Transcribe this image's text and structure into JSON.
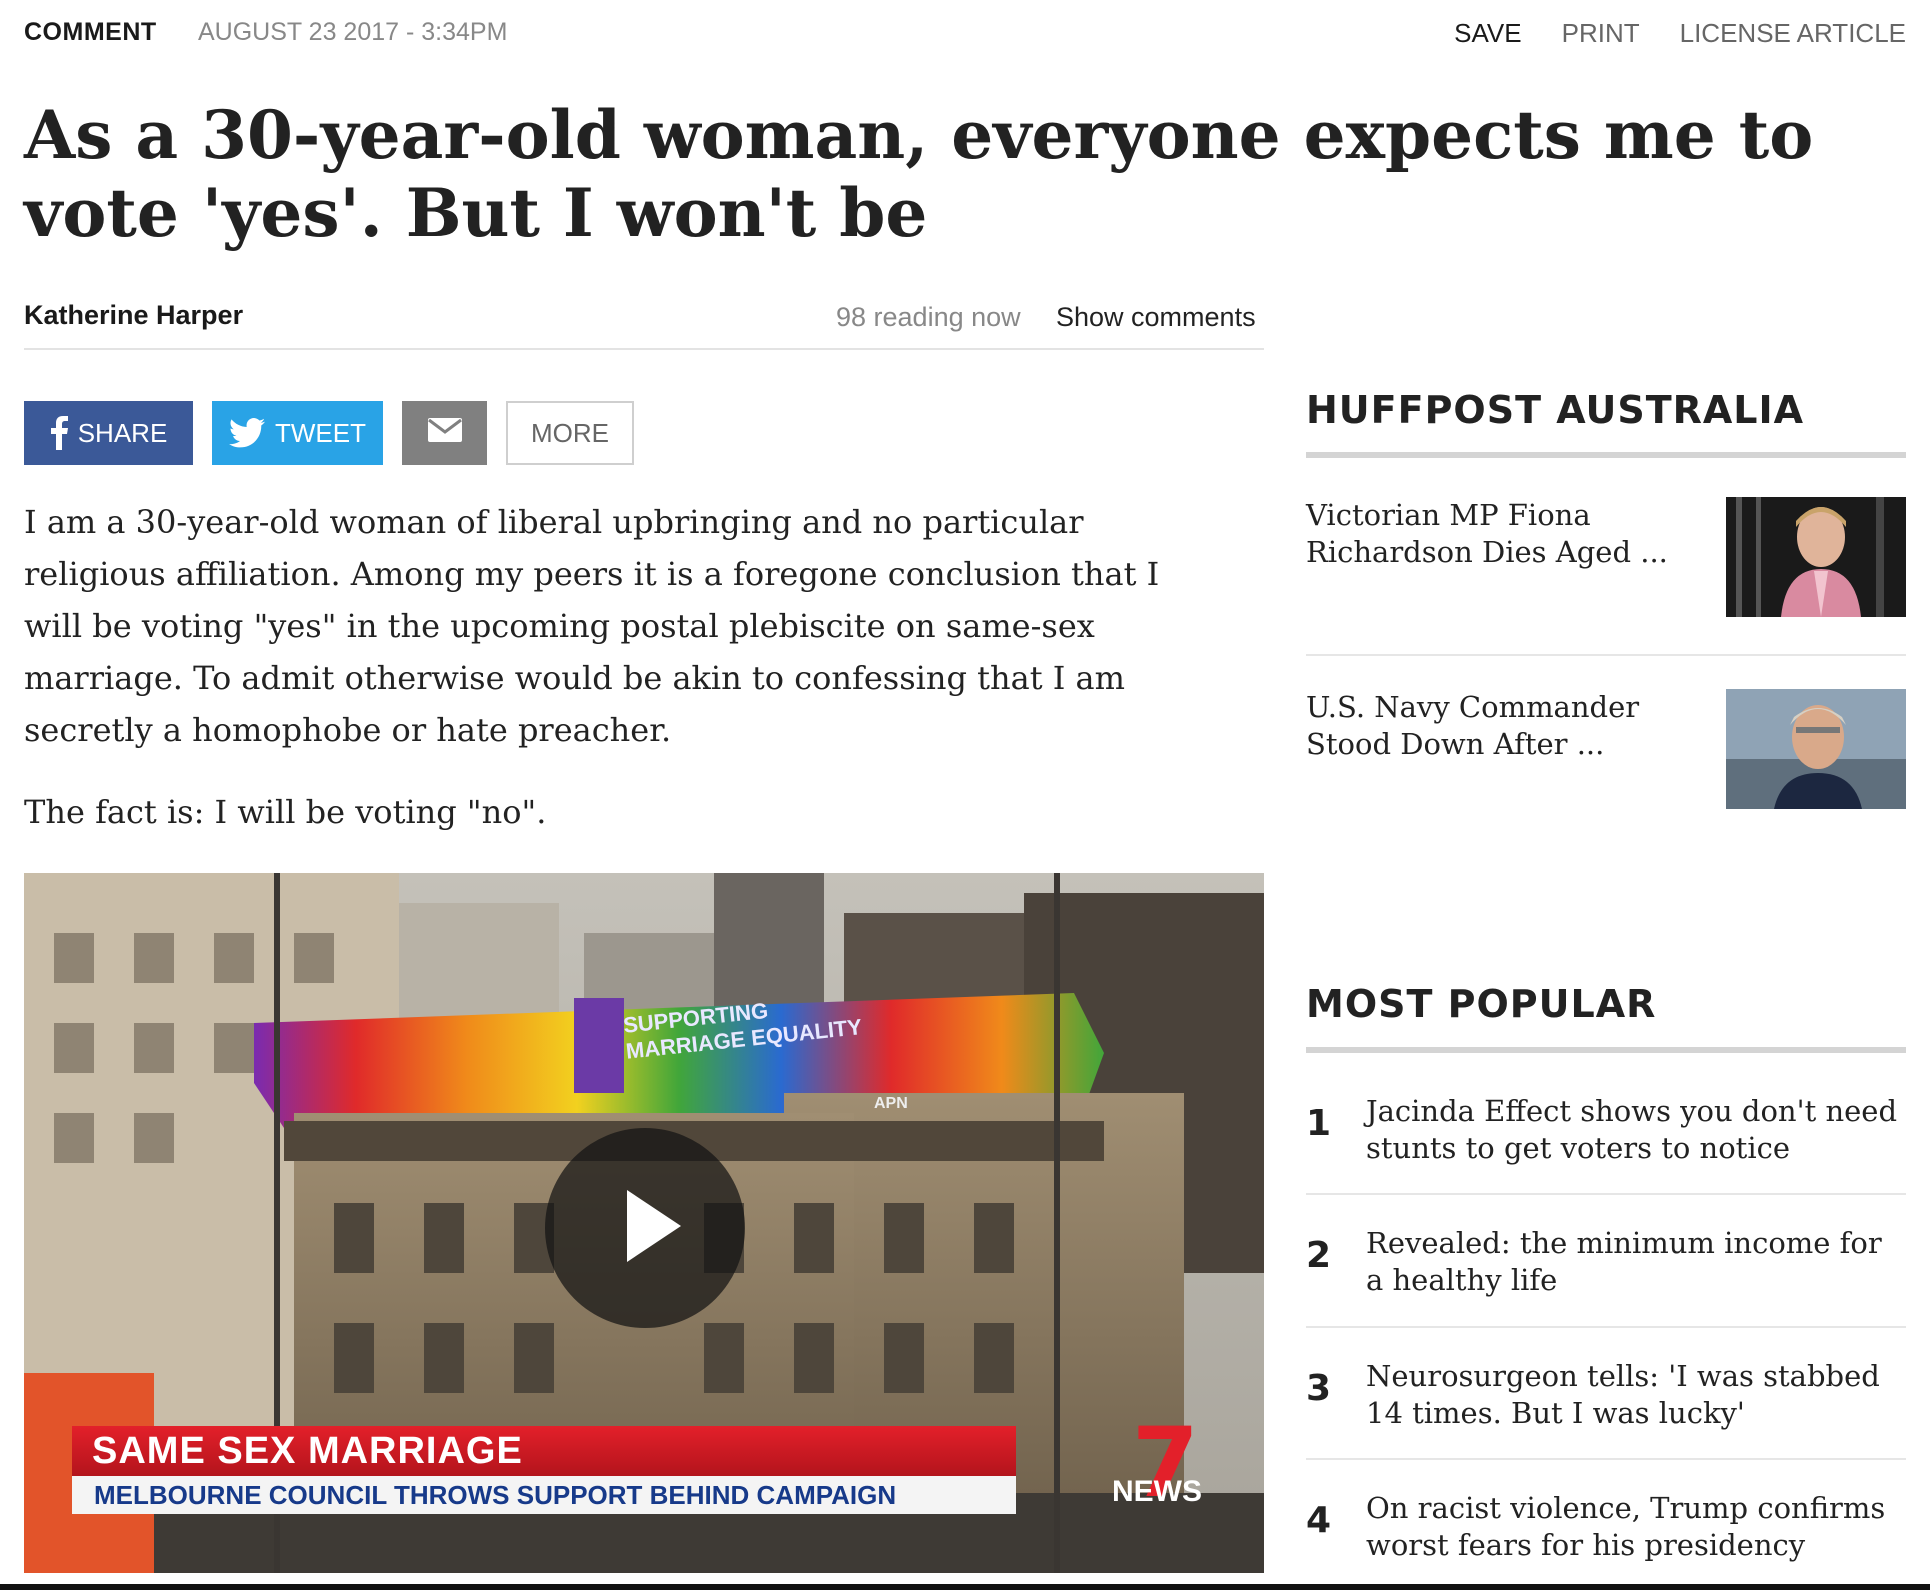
{
  "topbar": {
    "section": "COMMENT",
    "date": "AUGUST 23 2017 - 3:34PM",
    "actions": [
      "SAVE",
      "PRINT",
      "LICENSE ARTICLE"
    ]
  },
  "article": {
    "headline": "As a 30-year-old woman, everyone expects me to vote 'yes'. But I won't be",
    "author": "Katherine Harper",
    "reading_now": "98 reading now",
    "show_comments": "Show comments",
    "paragraphs": [
      "I am a 30-year-old woman of liberal upbringing and no particular religious affiliation. Among my peers it is a foregone conclusion that I will be voting \"yes\" in the upcoming postal plebiscite on same-sex marriage. To admit otherwise would be akin to confessing that I am secretly a homophobe or hate preacher.",
      "The fact is: I will be voting \"no\"."
    ]
  },
  "share": {
    "facebook": "SHARE",
    "twitter": "TWEET",
    "more": "MORE",
    "colors": {
      "facebook": "#3b5998",
      "twitter": "#29a3e6",
      "email": "#808080"
    }
  },
  "video": {
    "billboard": [
      "SUPPORTING",
      "MARRIAGE EQUALITY"
    ],
    "billboard_tag": "APN",
    "lower_third_title": "SAME SEX MARRIAGE",
    "lower_third_subtitle": "MELBOURNE COUNCIL THROWS SUPPORT BEHIND CAMPAIGN",
    "channel_logo_number": "7",
    "channel_logo_word": "NEWS"
  },
  "sidebar": {
    "huffpost_heading": "HUFFPOST AUSTRALIA",
    "huffpost_items": [
      {
        "title": "Victorian MP Fiona Richardson Dies Aged ...",
        "thumb_icon": "woman-portrait-photo"
      },
      {
        "title": "U.S. Navy Commander Stood Down After ...",
        "thumb_icon": "man-portrait-photo"
      }
    ],
    "popular_heading": "MOST POPULAR",
    "popular_items": [
      {
        "num": "1",
        "title": "Jacinda Effect shows you don't need stunts to get voters to notice"
      },
      {
        "num": "2",
        "title": "Revealed: the minimum income for a healthy life"
      },
      {
        "num": "3",
        "title": "Neurosurgeon tells: 'I was stabbed 14 times. But I was lucky'"
      },
      {
        "num": "4",
        "title": "On racist violence, Trump confirms worst fears for his presidency"
      }
    ]
  }
}
